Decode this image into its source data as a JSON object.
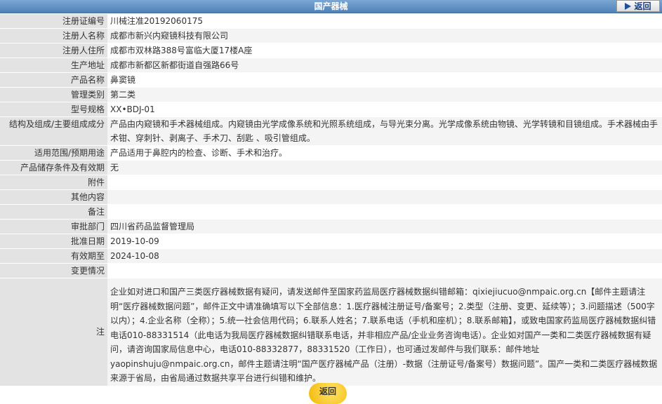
{
  "header": {
    "title": "国产器械",
    "back_label": "返回"
  },
  "rows": [
    {
      "label": "注册证编号",
      "value": "川械注准20192060175"
    },
    {
      "label": "注册人名称",
      "value": "成都市新兴内窥镜科技有限公司"
    },
    {
      "label": "注册人住所",
      "value": "成都市双林路388号富临大厦17楼A座"
    },
    {
      "label": "生产地址",
      "value": "成都市新都区新都街道自强路66号"
    },
    {
      "label": "产品名称",
      "value": "鼻窦镜"
    },
    {
      "label": "管理类别",
      "value": "第二类"
    },
    {
      "label": "型号规格",
      "value": "XX•BDJ-01"
    },
    {
      "label": "结构及组成/主要组成成分",
      "value": "产品由内窥镜和手术器械组成。内窥镜由光学成像系统和光照系统组成，与导光束分离。光学成像系统由物镜、光学转镜和目镜组成。手术器械由手术钳、穿刺针、剥离子、手术刀、刮匙 、吸引管组成。"
    },
    {
      "label": "适用范围/预期用途",
      "value": "产品适用于鼻腔内的检查、诊断、手术和治疗。"
    },
    {
      "label": "产品储存条件及有效期",
      "value": "无"
    },
    {
      "label": "附件",
      "value": ""
    },
    {
      "label": "其他内容",
      "value": ""
    },
    {
      "label": "备注",
      "value": ""
    },
    {
      "label": "审批部门",
      "value": "四川省药品监督管理局"
    },
    {
      "label": "批准日期",
      "value": "2019-10-09"
    },
    {
      "label": "有效期至",
      "value": "2024-10-08"
    },
    {
      "label": "变更情况",
      "value": ""
    }
  ],
  "note": {
    "label": "注",
    "text": "企业如对进口和国产三类医疗器械数据有疑问，请发送邮件至国家药监局医疗器械数据纠错邮箱：qixiejiucuo@nmpaic.org.cn【邮件主题请注明“医疗器械数据问题”，邮件正文中请准确填写以下全部信息：1.医疗器械注册证号/备案号；2.类型（注册、变更、延续等）；3.问题描述（500字以内）；4.企业名称（全称）；5.统一社会信用代码；6.联系人姓名；7.联系电话（手机和座机）；8.联系邮箱】，或致电国家药监局医疗器械数据纠错电话010-88331514（此电话为我局医疗器械数据纠错联系电话，并非相应产品/企业业务咨询电话）。企业如对国产一类和二类医疗器械数据有疑问，请咨询国家局信息中心，电话010-88332877，88331520（工作日），也可通过发邮件与我们联系：邮件地址yaopinshuju@nmpaic.org.cn，邮件主题请注明“国产医疗器械产品（注册）-数据（注册证号/备案号）数据问题”。国产一类和二类医疗器械数据来源于省局，由省局通过数据共享平台进行纠错和维护。"
  },
  "footer": {
    "back_label": "返回"
  }
}
